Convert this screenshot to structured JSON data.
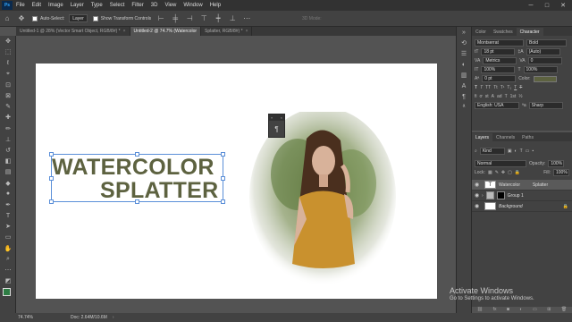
{
  "app": {
    "logo": "Ps"
  },
  "menu": [
    "File",
    "Edit",
    "Image",
    "Layer",
    "Type",
    "Select",
    "Filter",
    "3D",
    "View",
    "Window",
    "Help"
  ],
  "window_controls": {
    "minimize": "─",
    "maximize": "□",
    "close": "✕"
  },
  "options": {
    "auto_select_label": "Auto-Select:",
    "auto_select_value": "Layer",
    "show_transform_label": "Show Transform Controls",
    "mode_3d": "3D Mode:"
  },
  "tabs": [
    {
      "label": "Untitled-1 @ 28% (Vector Smart Object, RGB/8#) *",
      "close": "×"
    },
    {
      "label": "Untitled-2 @ 74.7% (Watercolor",
      "close": ""
    },
    {
      "label": "Splatter, RGB/8#) *",
      "close": "×"
    }
  ],
  "canvas": {
    "line1": "WATERCOLOR",
    "line2": "SPLATTER"
  },
  "char_panel": {
    "tabs": [
      "Color",
      "Swatches",
      "Character"
    ],
    "font": "Montserrat",
    "style": "Bold",
    "size": "18 pt",
    "leading": "(Auto)",
    "kerning": "Metrics",
    "tracking": "0",
    "vscale": "100%",
    "hscale": "100%",
    "baseline": "0 pt",
    "color_label": "Color:",
    "language": "English: USA",
    "aa": "Sharp",
    "type_buttons": [
      "T",
      "T",
      "TT",
      "Tt",
      "T¹",
      "T₁",
      "T",
      "T"
    ],
    "ot_buttons": [
      "fi",
      "ơ",
      "st",
      "A",
      "ad",
      "T",
      "1st",
      "½"
    ]
  },
  "layers_panel": {
    "tabs": [
      "Layers",
      "Channels",
      "Paths"
    ],
    "kind": "Kind",
    "blend": "Normal",
    "opacity_label": "Opacity:",
    "opacity": "100%",
    "lock_label": "Lock:",
    "fill_label": "Fill:",
    "fill": "100%",
    "layers": [
      {
        "name": "Watercolor          Splatter",
        "thumb": "T"
      },
      {
        "name": "Group 1",
        "thumb": ""
      },
      {
        "name": "Background",
        "thumb": ""
      }
    ]
  },
  "status": {
    "zoom": "74.74%",
    "doc": "Doc: 2.64M/10.6M"
  },
  "activate": {
    "line1": "Activate Windows",
    "line2": "Go to Settings to activate Windows."
  },
  "colors": {
    "text": "#5d6240",
    "bg": "#535353"
  }
}
